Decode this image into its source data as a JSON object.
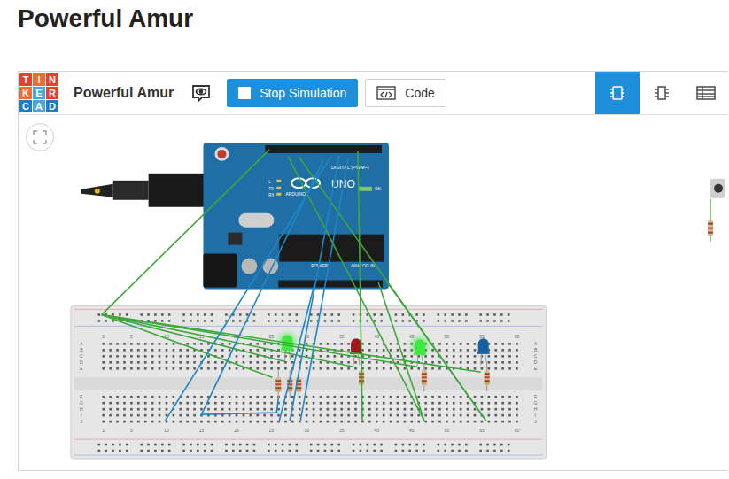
{
  "page_title": "Powerful Amur",
  "toolbar": {
    "logo": [
      {
        "letter": "T",
        "color": "#e8402f"
      },
      {
        "letter": "I",
        "color": "#f26b2a"
      },
      {
        "letter": "N",
        "color": "#e8402f"
      },
      {
        "letter": "K",
        "color": "#f26b2a"
      },
      {
        "letter": "E",
        "color": "#46a6dc"
      },
      {
        "letter": "R",
        "color": "#e8402f"
      },
      {
        "letter": "C",
        "color": "#1c7fc4"
      },
      {
        "letter": "A",
        "color": "#46a6dc"
      },
      {
        "letter": "D",
        "color": "#1c7fc4"
      }
    ],
    "project_name": "Powerful Amur",
    "buttons": [
      {
        "label": "Stop Simulation",
        "kind": "stop"
      },
      {
        "label": "Code",
        "kind": "code"
      }
    ],
    "views": [
      {
        "kind": "circuit",
        "selected": true
      },
      {
        "kind": "schematic",
        "selected": false
      },
      {
        "kind": "list",
        "selected": false
      }
    ]
  },
  "board": {
    "model": "UNO",
    "brand": "ARDUINO",
    "digital": "DIGITAL (PWM~)",
    "power": "POWER",
    "analog": "ANALOG IN",
    "on": "ON",
    "tx": "TX",
    "rx": "RX",
    "l": "L"
  },
  "breadboard": {
    "columns": [
      "1",
      "5",
      "10",
      "15",
      "20",
      "25",
      "30",
      "35",
      "40",
      "45",
      "50",
      "55",
      "60"
    ],
    "rows": [
      "A",
      "B",
      "C",
      "D",
      "E",
      "F",
      "G",
      "H",
      "I",
      "J"
    ]
  },
  "leds": [
    {
      "color": "#3ee83e",
      "on": true
    },
    {
      "color": "#a3151b",
      "on": false
    },
    {
      "color": "#3ee83e",
      "on": true
    },
    {
      "color": "#14619e",
      "on": false
    }
  ]
}
